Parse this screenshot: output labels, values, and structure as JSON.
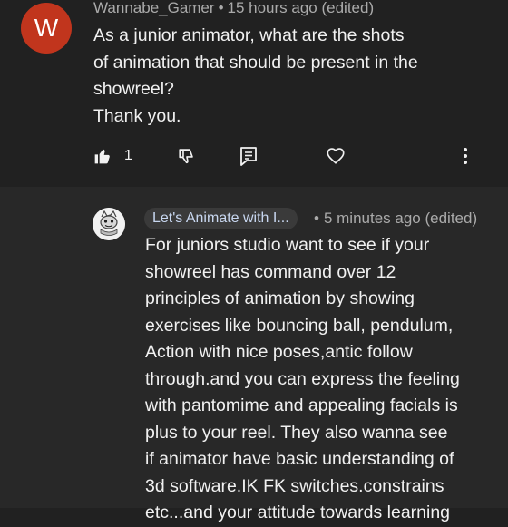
{
  "comment": {
    "avatar_letter": "W",
    "avatar_color": "#c1351d",
    "author": "Wannabe_Gamer",
    "separator": "•",
    "time": "15 hours ago (edited)",
    "text": "As a junior animator, what are the shots\nof animation that should be present in the\nshowreel?\nThank you.",
    "like_count": "1",
    "icons": [
      "thumbs-up-icon",
      "thumbs-down-icon",
      "comment-icon",
      "heart-icon",
      "more-vert-icon"
    ]
  },
  "reply": {
    "author": "Let's Animate with I...",
    "separator": "•",
    "time": "5 minutes ago (edited)",
    "text": "For juniors studio want to see if your\nshowreel has command over 12\nprinciples of animation by showing\nexercises like bouncing ball, pendulum,\nAction with nice poses,antic follow\nthrough.and you can  express the feeling\nwith pantomime and appealing facials is\nplus to your reel. They also wanna see\nif  animator have basic understanding of\n3d software.IK FK switches.constrains\netc...and your attitude towards learning"
  }
}
